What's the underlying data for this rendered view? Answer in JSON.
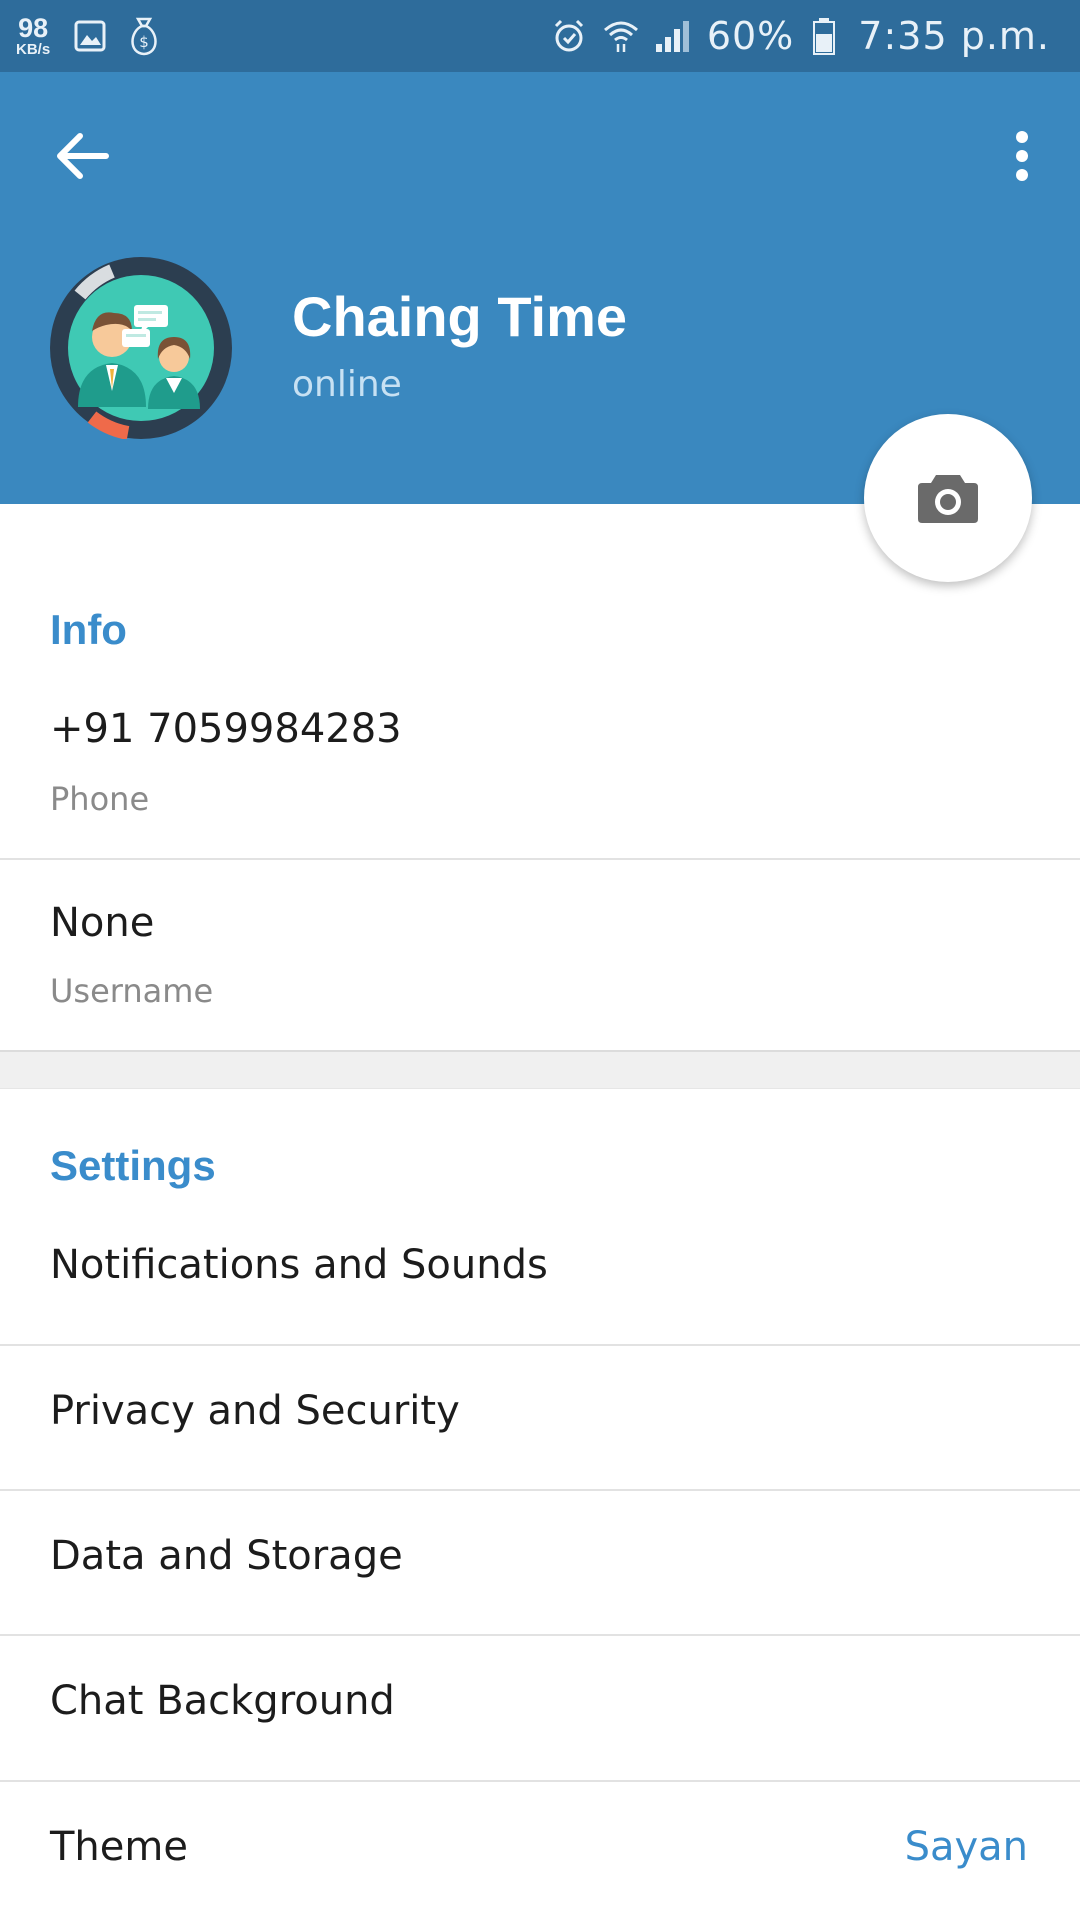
{
  "status_bar": {
    "speed_value": "98",
    "speed_unit": "KB/s",
    "battery_percent": "60%",
    "time": "7:35 p.m.",
    "left_icons": [
      "gallery-icon",
      "money-bag-icon"
    ],
    "right_icons": [
      "alarm-icon",
      "wifi-icon",
      "signal-icon",
      "battery-icon"
    ]
  },
  "header": {
    "back_icon": "arrow-left-icon",
    "menu_icon": "more-vertical-icon",
    "name": "Chaing Time",
    "status": "online",
    "camera_icon": "camera-icon"
  },
  "info": {
    "title": "Info",
    "phone_value": "+91 7059984283",
    "phone_label": "Phone",
    "username_value": "None",
    "username_label": "Username"
  },
  "settings": {
    "title": "Settings",
    "items": [
      {
        "label": "Notifications and Sounds"
      },
      {
        "label": "Privacy and Security"
      },
      {
        "label": "Data and Storage"
      },
      {
        "label": "Chat Background"
      },
      {
        "label": "Theme",
        "value": "Sayan"
      }
    ]
  },
  "colors": {
    "status_bar": "#2e6c9b",
    "header": "#3a88bf",
    "accent": "#3a8ccb"
  }
}
